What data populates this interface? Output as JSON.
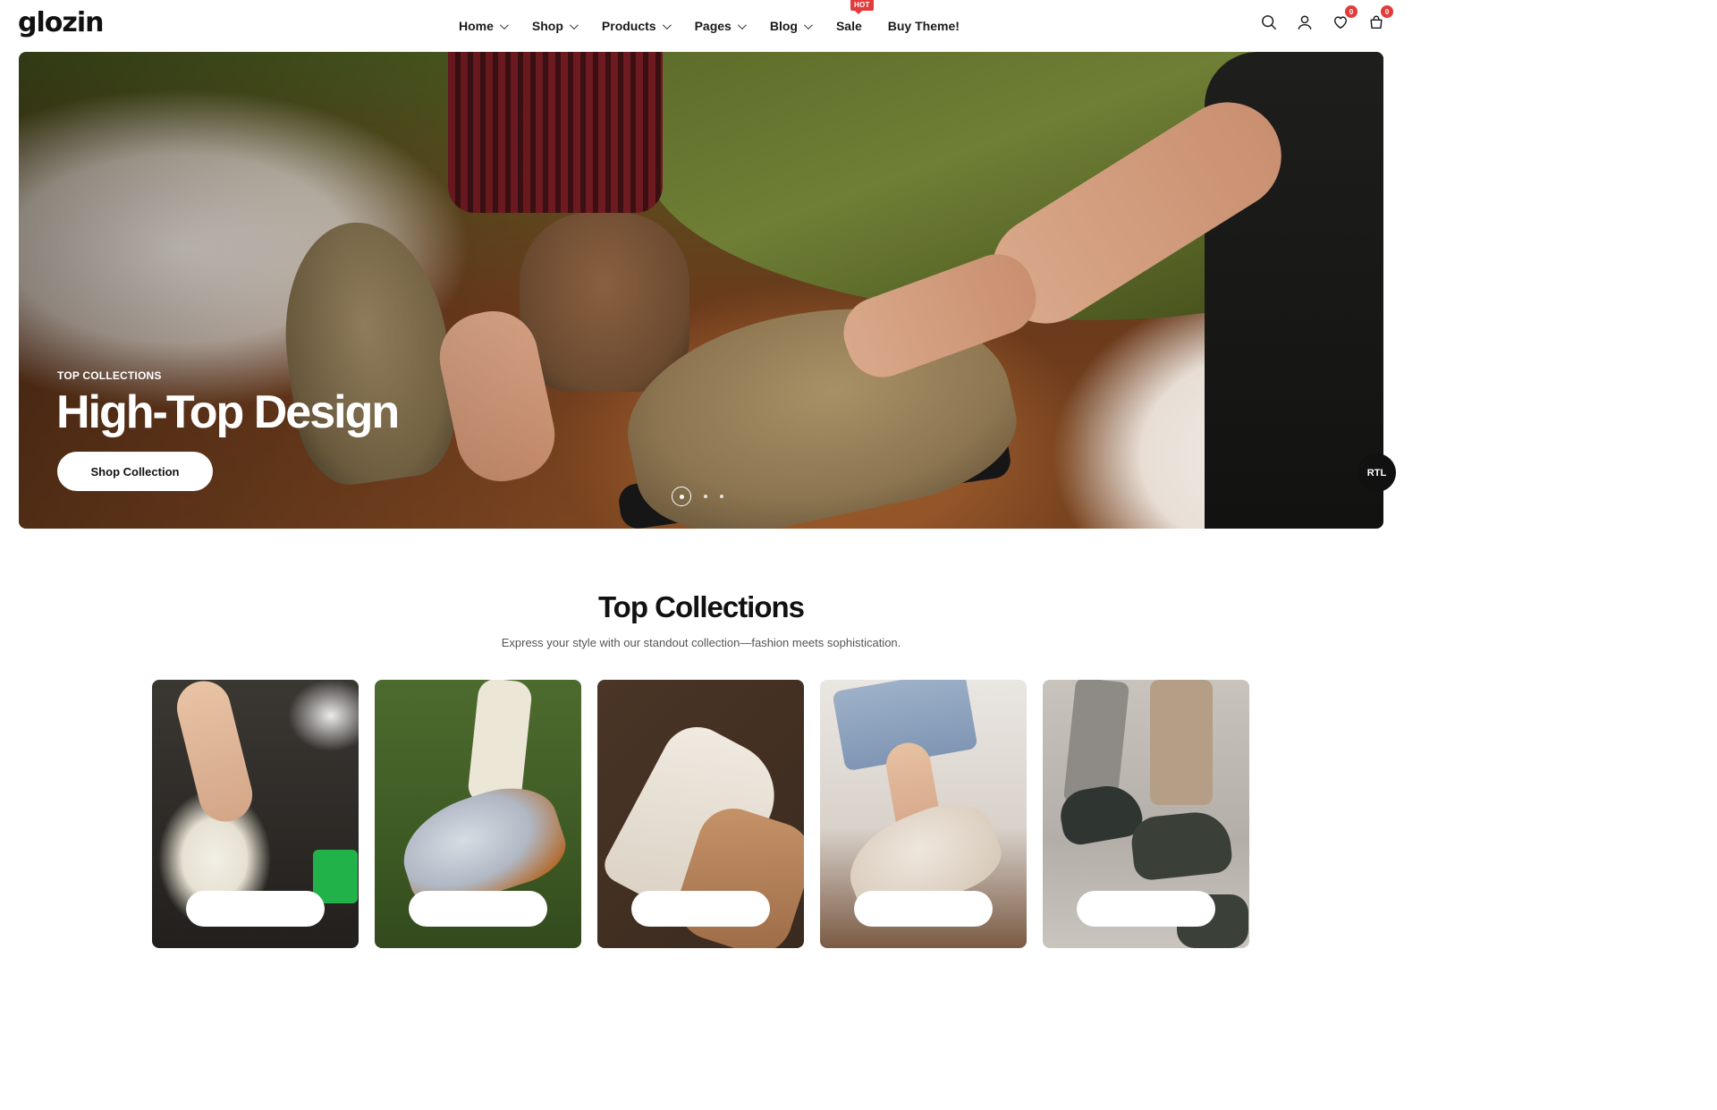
{
  "brand": {
    "logo_text": "glozin"
  },
  "nav": {
    "items": [
      {
        "label": "Home",
        "has_dropdown": true
      },
      {
        "label": "Shop",
        "has_dropdown": true
      },
      {
        "label": "Products",
        "has_dropdown": true
      },
      {
        "label": "Pages",
        "has_dropdown": true
      },
      {
        "label": "Blog",
        "has_dropdown": true
      },
      {
        "label": "Sale",
        "has_dropdown": false,
        "badge": "HOT"
      },
      {
        "label": "Buy Theme!",
        "has_dropdown": false
      }
    ]
  },
  "header_icons": {
    "search": "search-icon",
    "account": "user-icon",
    "wishlist": {
      "icon": "heart-icon",
      "count": "0"
    },
    "cart": {
      "icon": "cart-icon",
      "count": "0"
    }
  },
  "hero": {
    "eyebrow": "TOP COLLECTIONS",
    "title": "High-Top Design",
    "cta_label": "Shop Collection",
    "slides_total": 3,
    "active_slide": 1
  },
  "rtl_toggle": {
    "label": "RTL"
  },
  "collections": {
    "title": "Top Collections",
    "subtitle": "Express your style with our standout collection—fashion meets sophistication."
  },
  "colors": {
    "accent_badge": "#e23b3b",
    "text_primary": "#111111",
    "text_secondary": "#555555"
  }
}
